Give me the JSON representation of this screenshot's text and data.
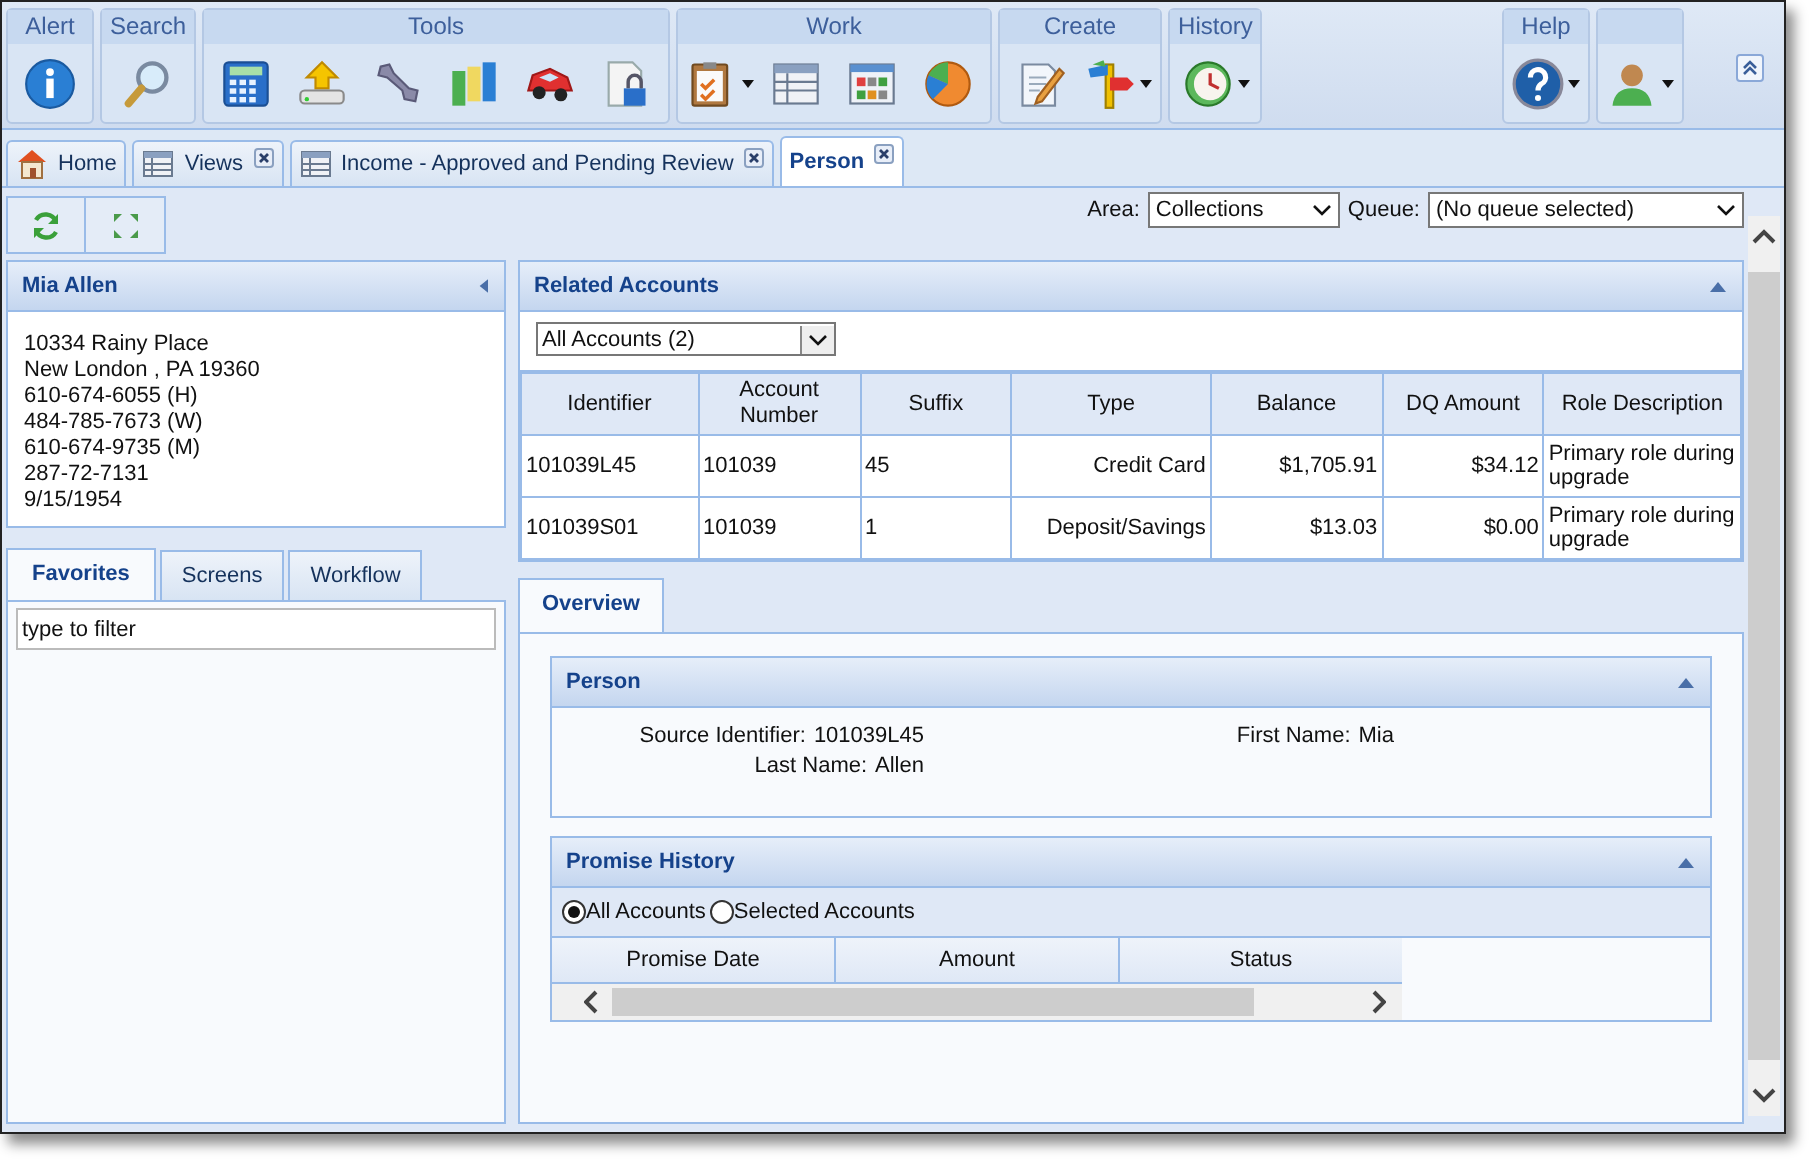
{
  "ribbon": {
    "groups": [
      {
        "title": "Alert",
        "icons": [
          {
            "kind": "info",
            "dropdown": false
          }
        ]
      },
      {
        "title": "Search",
        "icons": [
          {
            "kind": "search",
            "dropdown": false
          }
        ]
      },
      {
        "title": "Tools",
        "icons": [
          {
            "kind": "calculator",
            "dropdown": false
          },
          {
            "kind": "upload",
            "dropdown": false
          },
          {
            "kind": "wrench",
            "dropdown": false
          },
          {
            "kind": "bars",
            "dropdown": false
          },
          {
            "kind": "car",
            "dropdown": false
          },
          {
            "kind": "lockdoc",
            "dropdown": false
          }
        ]
      },
      {
        "title": "Work",
        "icons": [
          {
            "kind": "clipboard",
            "dropdown": true
          },
          {
            "kind": "table",
            "dropdown": false
          },
          {
            "kind": "tiles",
            "dropdown": false
          },
          {
            "kind": "pie",
            "dropdown": false
          }
        ]
      },
      {
        "title": "Create",
        "icons": [
          {
            "kind": "edit",
            "dropdown": false
          },
          {
            "kind": "signpost",
            "dropdown": true
          }
        ]
      },
      {
        "title": "History",
        "icons": [
          {
            "kind": "clock",
            "dropdown": true
          }
        ]
      }
    ],
    "right_groups": [
      {
        "title": "Help",
        "icons": [
          {
            "kind": "help",
            "dropdown": true
          }
        ]
      },
      {
        "icons": [
          {
            "kind": "user",
            "dropdown": true
          }
        ]
      }
    ]
  },
  "tabs": [
    {
      "label": "Home",
      "kind": "home",
      "closable": false,
      "selected": false
    },
    {
      "label": "Views",
      "kind": "table",
      "closable": true,
      "selected": false
    },
    {
      "label": "Income - Approved and Pending Review",
      "kind": "table",
      "closable": true,
      "selected": false
    },
    {
      "label": "Person",
      "kind": "plain",
      "closable": true,
      "selected": true
    }
  ],
  "toolbar": {
    "area": {
      "label": "Area:",
      "value": "Collections"
    },
    "queue": {
      "label": "Queue:",
      "value": "(No queue selected)"
    }
  },
  "person_card": {
    "name": "Mia Allen",
    "lines": [
      "10334 Rainy Place",
      "New London , PA 19360",
      "610-674-6055 (H)",
      "484-785-7673 (W)",
      "610-674-9735 (M)",
      "287-72-7131",
      "9/15/1954"
    ]
  },
  "side_tabs": [
    {
      "label": "Favorites",
      "selected": true
    },
    {
      "label": "Screens",
      "selected": false
    },
    {
      "label": "Workflow",
      "selected": false
    }
  ],
  "filter": {
    "value": "type to filter"
  },
  "related_accounts": {
    "title": "Related Accounts",
    "filter": "All Accounts (2)",
    "columns": [
      "Identifier",
      "Account Number",
      "Suffix",
      "Type",
      "Balance",
      "DQ Amount",
      "Role Description"
    ],
    "rows": [
      [
        "101039L45",
        "101039",
        "45",
        "Credit Card",
        "$1,705.91",
        "$34.12",
        "Primary role during upgrade"
      ],
      [
        "101039S01",
        "101039",
        "1",
        "Deposit/Savings",
        "$13.03",
        "$0.00",
        "Primary role during upgrade"
      ]
    ]
  },
  "detail_tabs": [
    {
      "label": "Overview",
      "selected": true
    }
  ],
  "person_section": {
    "title": "Person",
    "columns": [
      [
        {
          "label": "Source Identifier:",
          "value": "101039L45"
        },
        {
          "label": "Last Name:",
          "value": "Allen"
        }
      ],
      [
        {
          "label": "First Name:",
          "value": "Mia"
        }
      ]
    ]
  },
  "promise_history": {
    "title": "Promise History",
    "scope": [
      {
        "label": "All Accounts",
        "selected": true
      },
      {
        "label": "Selected Accounts",
        "selected": false
      }
    ],
    "columns": [
      "Promise Date",
      "Amount",
      "Status"
    ]
  }
}
